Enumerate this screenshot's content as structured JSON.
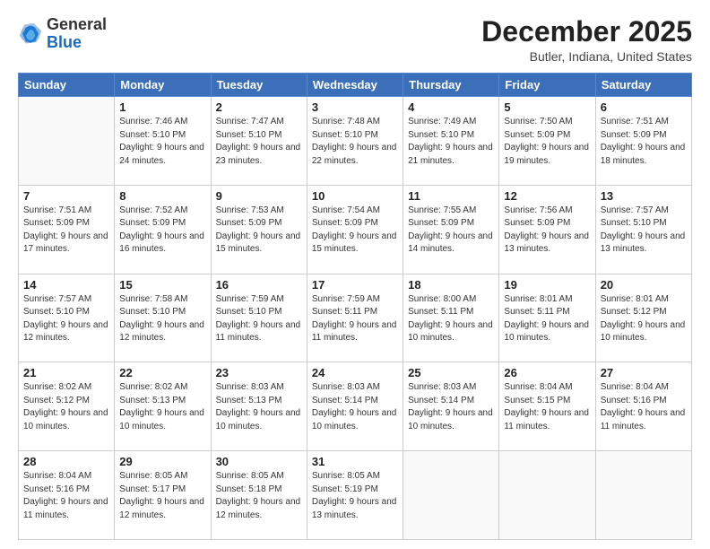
{
  "header": {
    "logo_general": "General",
    "logo_blue": "Blue",
    "month_title": "December 2025",
    "location": "Butler, Indiana, United States"
  },
  "days_of_week": [
    "Sunday",
    "Monday",
    "Tuesday",
    "Wednesday",
    "Thursday",
    "Friday",
    "Saturday"
  ],
  "weeks": [
    [
      {
        "day": "",
        "sunrise": "",
        "sunset": "",
        "daylight": ""
      },
      {
        "day": "1",
        "sunrise": "Sunrise: 7:46 AM",
        "sunset": "Sunset: 5:10 PM",
        "daylight": "Daylight: 9 hours and 24 minutes."
      },
      {
        "day": "2",
        "sunrise": "Sunrise: 7:47 AM",
        "sunset": "Sunset: 5:10 PM",
        "daylight": "Daylight: 9 hours and 23 minutes."
      },
      {
        "day": "3",
        "sunrise": "Sunrise: 7:48 AM",
        "sunset": "Sunset: 5:10 PM",
        "daylight": "Daylight: 9 hours and 22 minutes."
      },
      {
        "day": "4",
        "sunrise": "Sunrise: 7:49 AM",
        "sunset": "Sunset: 5:10 PM",
        "daylight": "Daylight: 9 hours and 21 minutes."
      },
      {
        "day": "5",
        "sunrise": "Sunrise: 7:50 AM",
        "sunset": "Sunset: 5:09 PM",
        "daylight": "Daylight: 9 hours and 19 minutes."
      },
      {
        "day": "6",
        "sunrise": "Sunrise: 7:51 AM",
        "sunset": "Sunset: 5:09 PM",
        "daylight": "Daylight: 9 hours and 18 minutes."
      }
    ],
    [
      {
        "day": "7",
        "sunrise": "Sunrise: 7:51 AM",
        "sunset": "Sunset: 5:09 PM",
        "daylight": "Daylight: 9 hours and 17 minutes."
      },
      {
        "day": "8",
        "sunrise": "Sunrise: 7:52 AM",
        "sunset": "Sunset: 5:09 PM",
        "daylight": "Daylight: 9 hours and 16 minutes."
      },
      {
        "day": "9",
        "sunrise": "Sunrise: 7:53 AM",
        "sunset": "Sunset: 5:09 PM",
        "daylight": "Daylight: 9 hours and 15 minutes."
      },
      {
        "day": "10",
        "sunrise": "Sunrise: 7:54 AM",
        "sunset": "Sunset: 5:09 PM",
        "daylight": "Daylight: 9 hours and 15 minutes."
      },
      {
        "day": "11",
        "sunrise": "Sunrise: 7:55 AM",
        "sunset": "Sunset: 5:09 PM",
        "daylight": "Daylight: 9 hours and 14 minutes."
      },
      {
        "day": "12",
        "sunrise": "Sunrise: 7:56 AM",
        "sunset": "Sunset: 5:09 PM",
        "daylight": "Daylight: 9 hours and 13 minutes."
      },
      {
        "day": "13",
        "sunrise": "Sunrise: 7:57 AM",
        "sunset": "Sunset: 5:10 PM",
        "daylight": "Daylight: 9 hours and 13 minutes."
      }
    ],
    [
      {
        "day": "14",
        "sunrise": "Sunrise: 7:57 AM",
        "sunset": "Sunset: 5:10 PM",
        "daylight": "Daylight: 9 hours and 12 minutes."
      },
      {
        "day": "15",
        "sunrise": "Sunrise: 7:58 AM",
        "sunset": "Sunset: 5:10 PM",
        "daylight": "Daylight: 9 hours and 12 minutes."
      },
      {
        "day": "16",
        "sunrise": "Sunrise: 7:59 AM",
        "sunset": "Sunset: 5:10 PM",
        "daylight": "Daylight: 9 hours and 11 minutes."
      },
      {
        "day": "17",
        "sunrise": "Sunrise: 7:59 AM",
        "sunset": "Sunset: 5:11 PM",
        "daylight": "Daylight: 9 hours and 11 minutes."
      },
      {
        "day": "18",
        "sunrise": "Sunrise: 8:00 AM",
        "sunset": "Sunset: 5:11 PM",
        "daylight": "Daylight: 9 hours and 10 minutes."
      },
      {
        "day": "19",
        "sunrise": "Sunrise: 8:01 AM",
        "sunset": "Sunset: 5:11 PM",
        "daylight": "Daylight: 9 hours and 10 minutes."
      },
      {
        "day": "20",
        "sunrise": "Sunrise: 8:01 AM",
        "sunset": "Sunset: 5:12 PM",
        "daylight": "Daylight: 9 hours and 10 minutes."
      }
    ],
    [
      {
        "day": "21",
        "sunrise": "Sunrise: 8:02 AM",
        "sunset": "Sunset: 5:12 PM",
        "daylight": "Daylight: 9 hours and 10 minutes."
      },
      {
        "day": "22",
        "sunrise": "Sunrise: 8:02 AM",
        "sunset": "Sunset: 5:13 PM",
        "daylight": "Daylight: 9 hours and 10 minutes."
      },
      {
        "day": "23",
        "sunrise": "Sunrise: 8:03 AM",
        "sunset": "Sunset: 5:13 PM",
        "daylight": "Daylight: 9 hours and 10 minutes."
      },
      {
        "day": "24",
        "sunrise": "Sunrise: 8:03 AM",
        "sunset": "Sunset: 5:14 PM",
        "daylight": "Daylight: 9 hours and 10 minutes."
      },
      {
        "day": "25",
        "sunrise": "Sunrise: 8:03 AM",
        "sunset": "Sunset: 5:14 PM",
        "daylight": "Daylight: 9 hours and 10 minutes."
      },
      {
        "day": "26",
        "sunrise": "Sunrise: 8:04 AM",
        "sunset": "Sunset: 5:15 PM",
        "daylight": "Daylight: 9 hours and 11 minutes."
      },
      {
        "day": "27",
        "sunrise": "Sunrise: 8:04 AM",
        "sunset": "Sunset: 5:16 PM",
        "daylight": "Daylight: 9 hours and 11 minutes."
      }
    ],
    [
      {
        "day": "28",
        "sunrise": "Sunrise: 8:04 AM",
        "sunset": "Sunset: 5:16 PM",
        "daylight": "Daylight: 9 hours and 11 minutes."
      },
      {
        "day": "29",
        "sunrise": "Sunrise: 8:05 AM",
        "sunset": "Sunset: 5:17 PM",
        "daylight": "Daylight: 9 hours and 12 minutes."
      },
      {
        "day": "30",
        "sunrise": "Sunrise: 8:05 AM",
        "sunset": "Sunset: 5:18 PM",
        "daylight": "Daylight: 9 hours and 12 minutes."
      },
      {
        "day": "31",
        "sunrise": "Sunrise: 8:05 AM",
        "sunset": "Sunset: 5:19 PM",
        "daylight": "Daylight: 9 hours and 13 minutes."
      },
      {
        "day": "",
        "sunrise": "",
        "sunset": "",
        "daylight": ""
      },
      {
        "day": "",
        "sunrise": "",
        "sunset": "",
        "daylight": ""
      },
      {
        "day": "",
        "sunrise": "",
        "sunset": "",
        "daylight": ""
      }
    ]
  ]
}
